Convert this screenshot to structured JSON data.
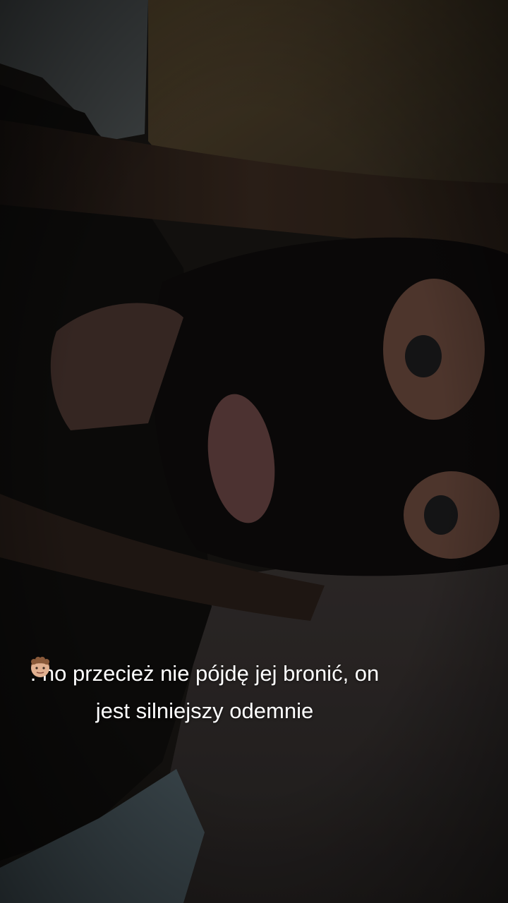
{
  "caption": {
    "speaker_emoji_name": "boy-curly-hair-medium-light-skin-emoji",
    "text": ": no przecież nie pójdę jej bronić, on jest silniejszy odemnie"
  },
  "colors": {
    "overlay_dim": "#000000",
    "mask": "#0e0c0c",
    "hair": "#2a1e18",
    "floor": "#3a3433",
    "wall": "#4a3d28"
  }
}
